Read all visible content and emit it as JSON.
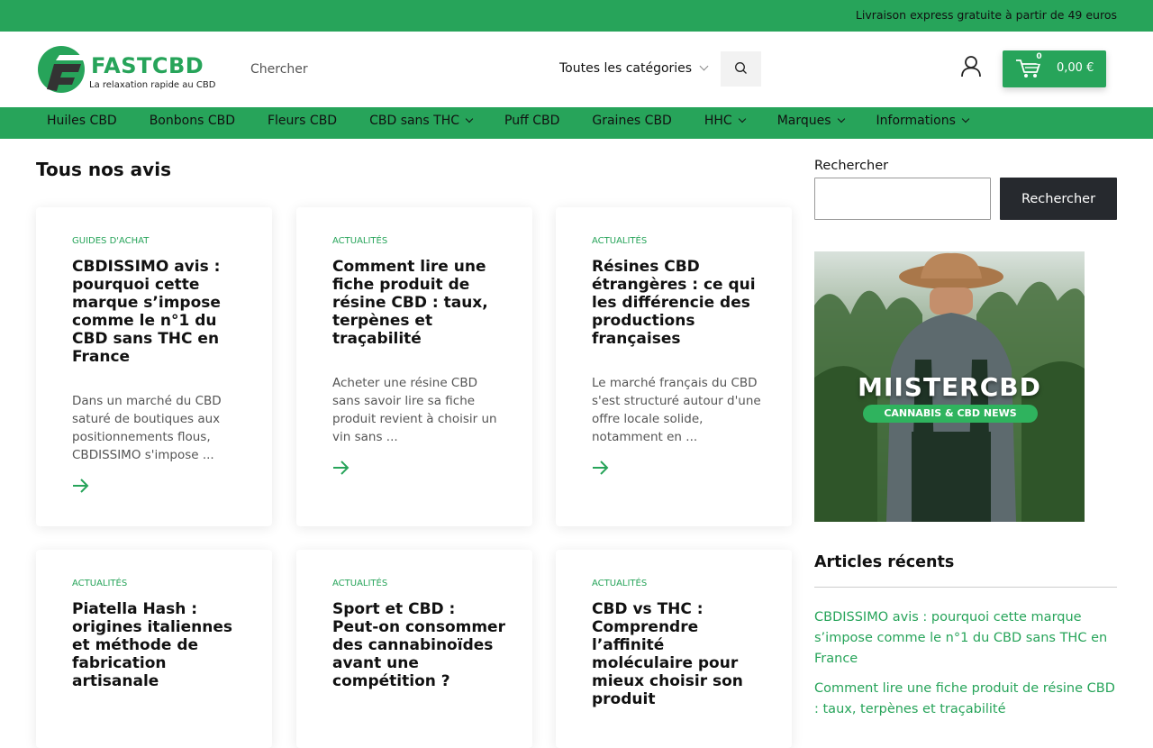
{
  "topbar": {
    "promo": "Livraison express gratuite à partir de 49 euros"
  },
  "header": {
    "logo": {
      "brand": "FASTCBD",
      "tagline": "La relaxation rapide au CBD"
    },
    "search": {
      "placeholder": "Chercher",
      "category": "Toutes les catégories"
    },
    "cart": {
      "count": "0",
      "amount": "0,00 €"
    }
  },
  "nav": {
    "items": [
      {
        "label": "Huiles CBD",
        "dropdown": false
      },
      {
        "label": "Bonbons CBD",
        "dropdown": false
      },
      {
        "label": "Fleurs CBD",
        "dropdown": false
      },
      {
        "label": "CBD sans THC",
        "dropdown": true
      },
      {
        "label": "Puff CBD",
        "dropdown": false
      },
      {
        "label": "Graines CBD",
        "dropdown": false
      },
      {
        "label": "HHC",
        "dropdown": true
      },
      {
        "label": "Marques",
        "dropdown": true
      },
      {
        "label": "Informations",
        "dropdown": true
      }
    ]
  },
  "main": {
    "title": "Tous nos avis",
    "posts": [
      {
        "category": "Guides d'achat",
        "title": "CBDISSIMO avis : pourquoi cette marque s’impose comme le n°1 du CBD sans THC en France",
        "excerpt": "Dans un marché du CBD saturé de boutiques aux positionnements flous, CBDISSIMO s'impose ..."
      },
      {
        "category": "Actualités",
        "title": "Comment lire une fiche produit de résine CBD : taux, terpènes et traçabilité",
        "excerpt": "Acheter une résine CBD sans savoir lire sa fiche produit revient à choisir un vin sans ..."
      },
      {
        "category": "Actualités",
        "title": "Résines CBD étrangères : ce qui les différencie des productions françaises",
        "excerpt": "Le marché français du CBD s'est structuré autour d'une offre locale solide, notamment en ..."
      },
      {
        "category": "Actualités",
        "title": "Piatella Hash : origines italiennes et méthode de fabrication artisanale",
        "excerpt": ""
      },
      {
        "category": "Actualités",
        "title": "Sport et CBD : Peut-on consommer des cannabinoïdes avant une compétition ?",
        "excerpt": ""
      },
      {
        "category": "Actualités",
        "title": "CBD vs THC : Comprendre l’affinité moléculaire pour mieux choisir son produit",
        "excerpt": ""
      }
    ]
  },
  "sidebar": {
    "search_label": "Rechercher",
    "search_button": "Rechercher",
    "ad": {
      "brand": "MIISTERCBD",
      "tagline": "CANNABIS & CBD NEWS"
    },
    "recent_title": "Articles récents",
    "recent": [
      "CBDISSIMO avis : pourquoi cette marque s’impose comme le n°1 du CBD sans THC en France",
      "Comment lire une fiche produit de résine CBD : taux, terpènes et traçabilité"
    ]
  },
  "colors": {
    "accent": "#27a45a",
    "dark_button": "#26292e"
  }
}
